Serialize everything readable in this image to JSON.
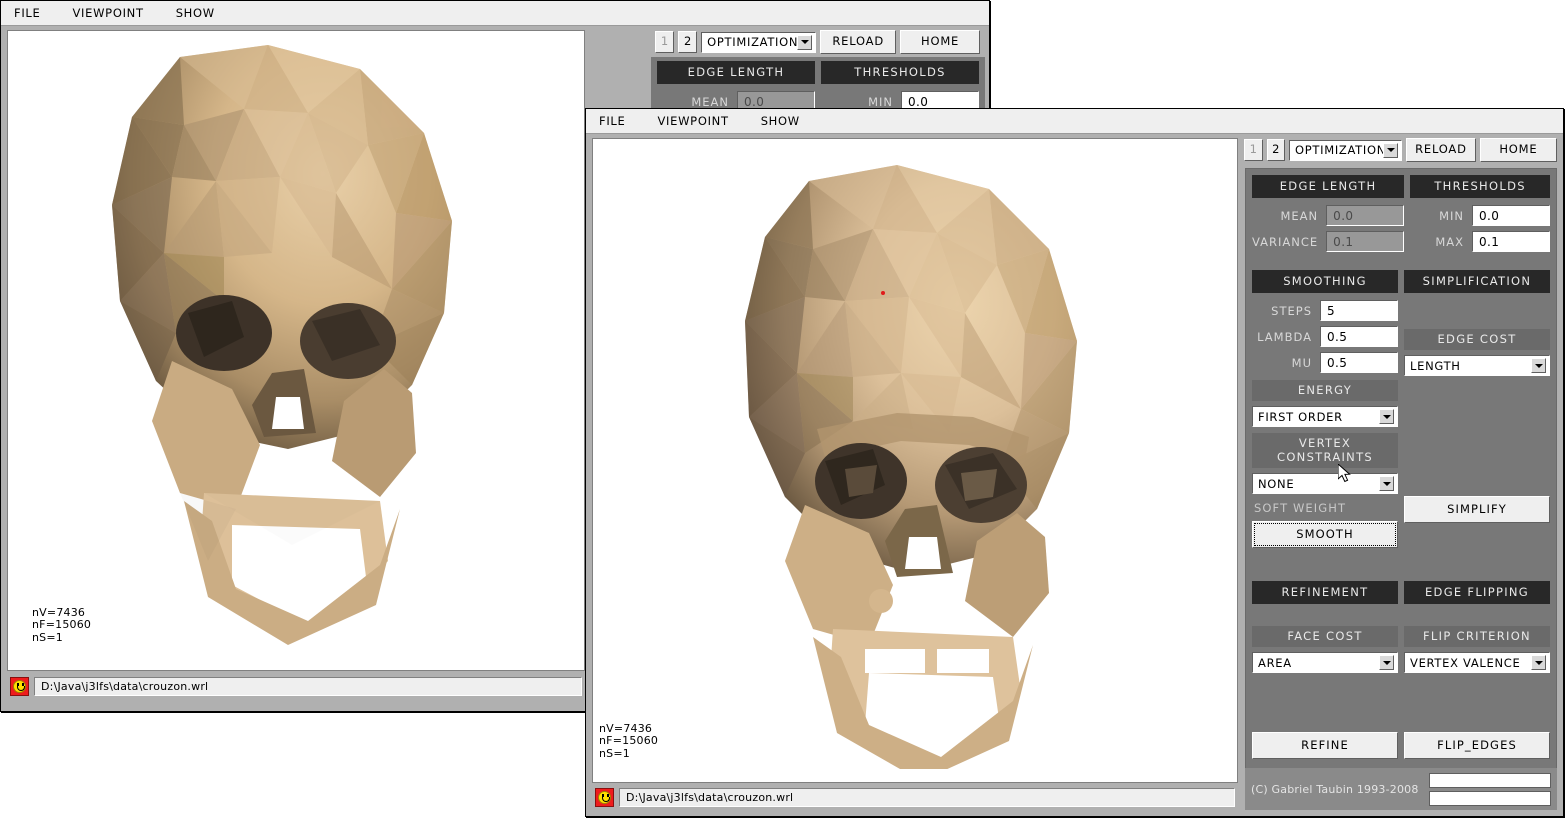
{
  "app": {
    "copyright": "(C) Gabriel Taubin 1993-2008",
    "accent_dark": "#282828",
    "panel_bg": "#787878",
    "chrome_bg": "#b0b0b0",
    "mesh_light": "#e0c49e",
    "mesh_dark": "#6b5840"
  },
  "menu": {
    "file": "FILE",
    "viewpoint": "VIEWPOINT",
    "show": "SHOW"
  },
  "toolbar": {
    "page_1": "1",
    "page_2": "2",
    "mode": "OPTIMIZATION",
    "reload": "RELOAD",
    "home": "HOME"
  },
  "edge_length": {
    "title": "EDGE LENGTH",
    "mean_label": "MEAN",
    "mean_value": "0.0",
    "variance_label": "VARIANCE",
    "variance_value": "0.1"
  },
  "thresholds": {
    "title": "THRESHOLDS",
    "min_label": "MIN",
    "min_value": "0.0",
    "max_label": "MAX",
    "max_value": "0.1"
  },
  "smoothing": {
    "title": "SMOOTHING",
    "steps_label": "STEPS",
    "steps_value": "5",
    "lambda_label": "LAMBDA",
    "lambda_value": "0.5",
    "mu_label": "MU",
    "mu_value": "0.5",
    "energy_title": "ENERGY",
    "energy_value": "FIRST ORDER",
    "vertex_constraints_title": "VERTEX CONSTRAINTS",
    "vertex_constraints_value": "NONE",
    "soft_weight_label": "SOFT WEIGHT",
    "smooth_button": "SMOOTH"
  },
  "simplification": {
    "title": "SIMPLIFICATION",
    "edge_cost_title": "EDGE COST",
    "edge_cost_value": "LENGTH",
    "simplify_button": "SIMPLIFY"
  },
  "refinement": {
    "title": "REFINEMENT",
    "face_cost_title": "FACE COST",
    "face_cost_value": "AREA",
    "refine_button": "REFINE"
  },
  "edge_flipping": {
    "title": "EDGE FLIPPING",
    "flip_criterion_title": "FLIP CRITERION",
    "flip_criterion_value": "VERTEX VALENCE",
    "flip_edges_button": "FLIP_EDGES"
  },
  "mesh_stats": {
    "vertices": "nV=7436",
    "faces": "nF=15060",
    "surfaces": "nS=1"
  },
  "status": {
    "path": "D:\\Java\\j3lfs\\data\\crouzon.wrl",
    "icon": "smiley-icon"
  }
}
